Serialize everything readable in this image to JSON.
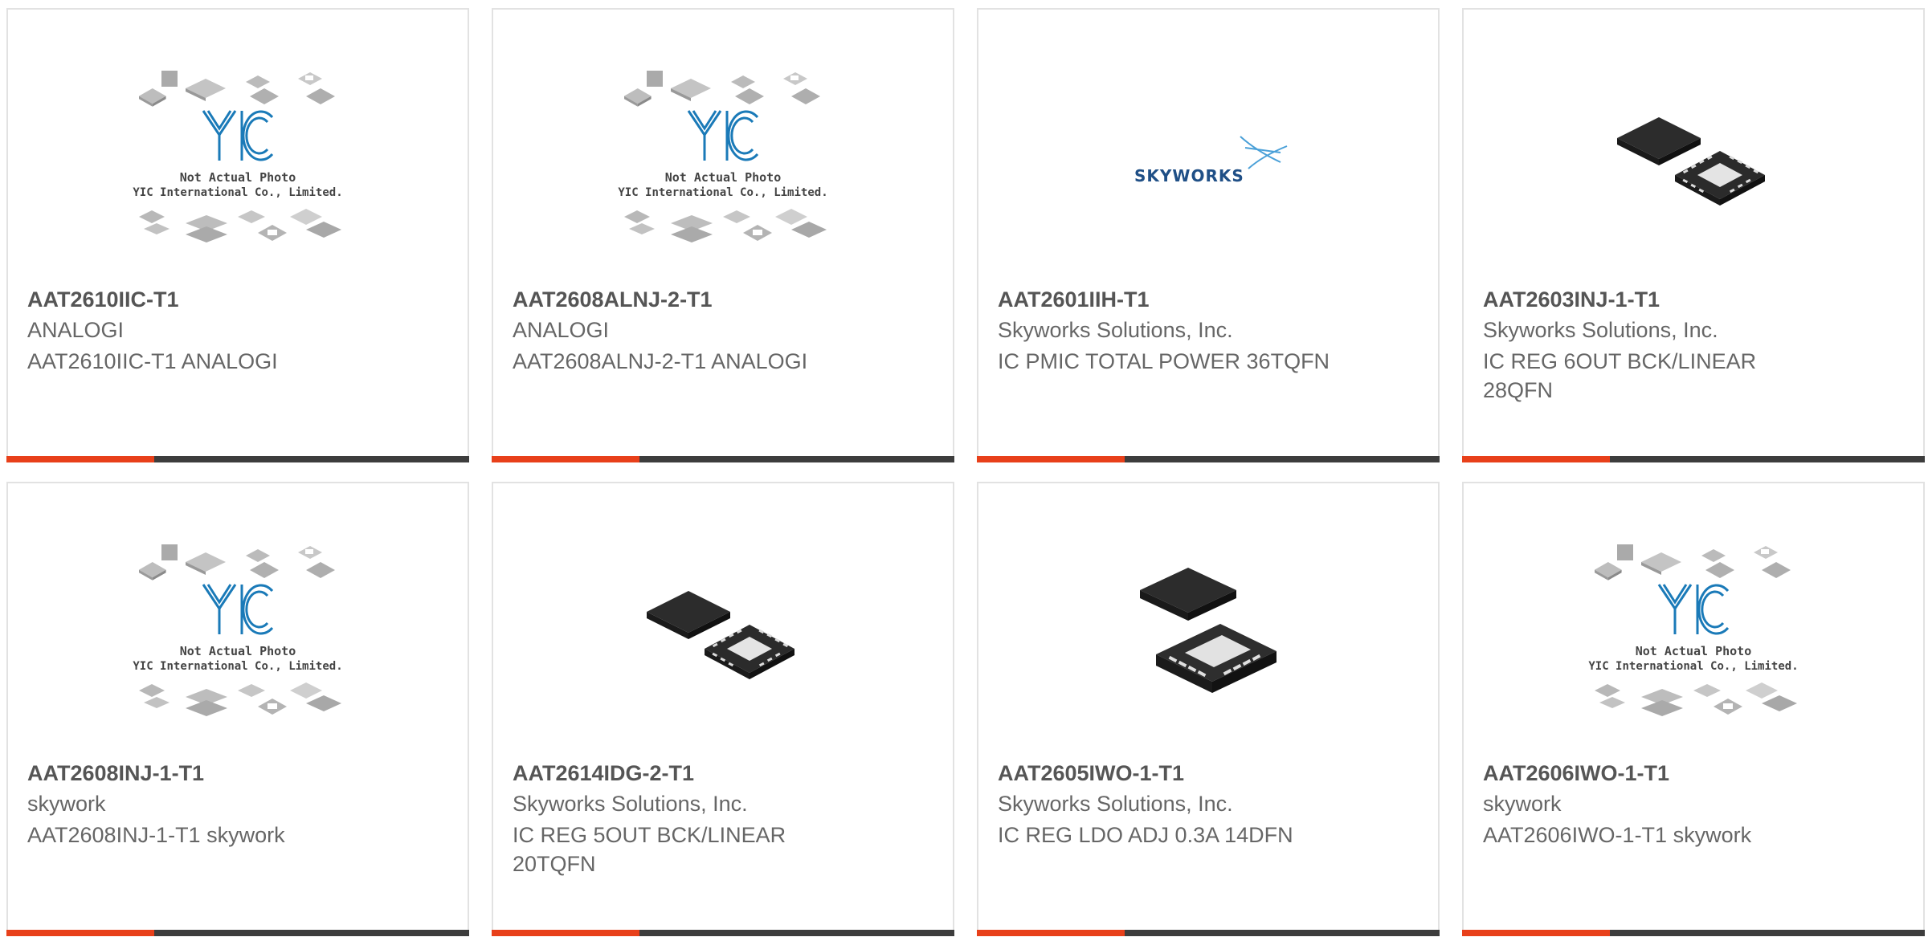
{
  "accent_color": "#e8401a",
  "bar_color": "#3d3d3d",
  "products": [
    {
      "part": "AAT2610IIC-T1",
      "manufacturer": "ANALOGI",
      "description": "AAT2610IIC-T1 ANALOGI",
      "image": "yic-placeholder",
      "image_caption_1": "Not Actual Photo",
      "image_caption_2": "YIC International Co., Limited.",
      "image_logo": "YIC"
    },
    {
      "part": "AAT2608ALNJ-2-T1",
      "manufacturer": "ANALOGI",
      "description": "AAT2608ALNJ-2-T1 ANALOGI",
      "image": "yic-placeholder",
      "image_caption_1": "Not Actual Photo",
      "image_caption_2": "YIC International Co., Limited.",
      "image_logo": "YIC"
    },
    {
      "part": "AAT2601IIH-T1",
      "manufacturer": "Skyworks Solutions, Inc.",
      "description": "IC PMIC TOTAL POWER 36TQFN",
      "image": "skyworks-logo",
      "image_logo": "SKYWORKS"
    },
    {
      "part": "AAT2603INJ-1-T1",
      "manufacturer": "Skyworks Solutions, Inc.",
      "description": "IC REG 6OUT BCK/LINEAR 28QFN",
      "image": "qfn-chip"
    },
    {
      "part": "AAT2608INJ-1-T1",
      "manufacturer": "skywork",
      "description": "AAT2608INJ-1-T1 skywork",
      "image": "yic-placeholder",
      "image_caption_1": "Not Actual Photo",
      "image_caption_2": "YIC International Co., Limited.",
      "image_logo": "YIC"
    },
    {
      "part": "AAT2614IDG-2-T1",
      "manufacturer": "Skyworks Solutions, Inc.",
      "description": "IC REG 5OUT BCK/LINEAR 20TQFN",
      "image": "qfn-chip"
    },
    {
      "part": "AAT2605IWO-1-T1",
      "manufacturer": "Skyworks Solutions, Inc.",
      "description": "IC REG LDO ADJ 0.3A 14DFN",
      "image": "dfn-chip"
    },
    {
      "part": "AAT2606IWO-1-T1",
      "manufacturer": "skywork",
      "description": "AAT2606IWO-1-T1 skywork",
      "image": "yic-placeholder",
      "image_caption_1": "Not Actual Photo",
      "image_caption_2": "YIC International Co., Limited.",
      "image_logo": "YIC"
    }
  ]
}
